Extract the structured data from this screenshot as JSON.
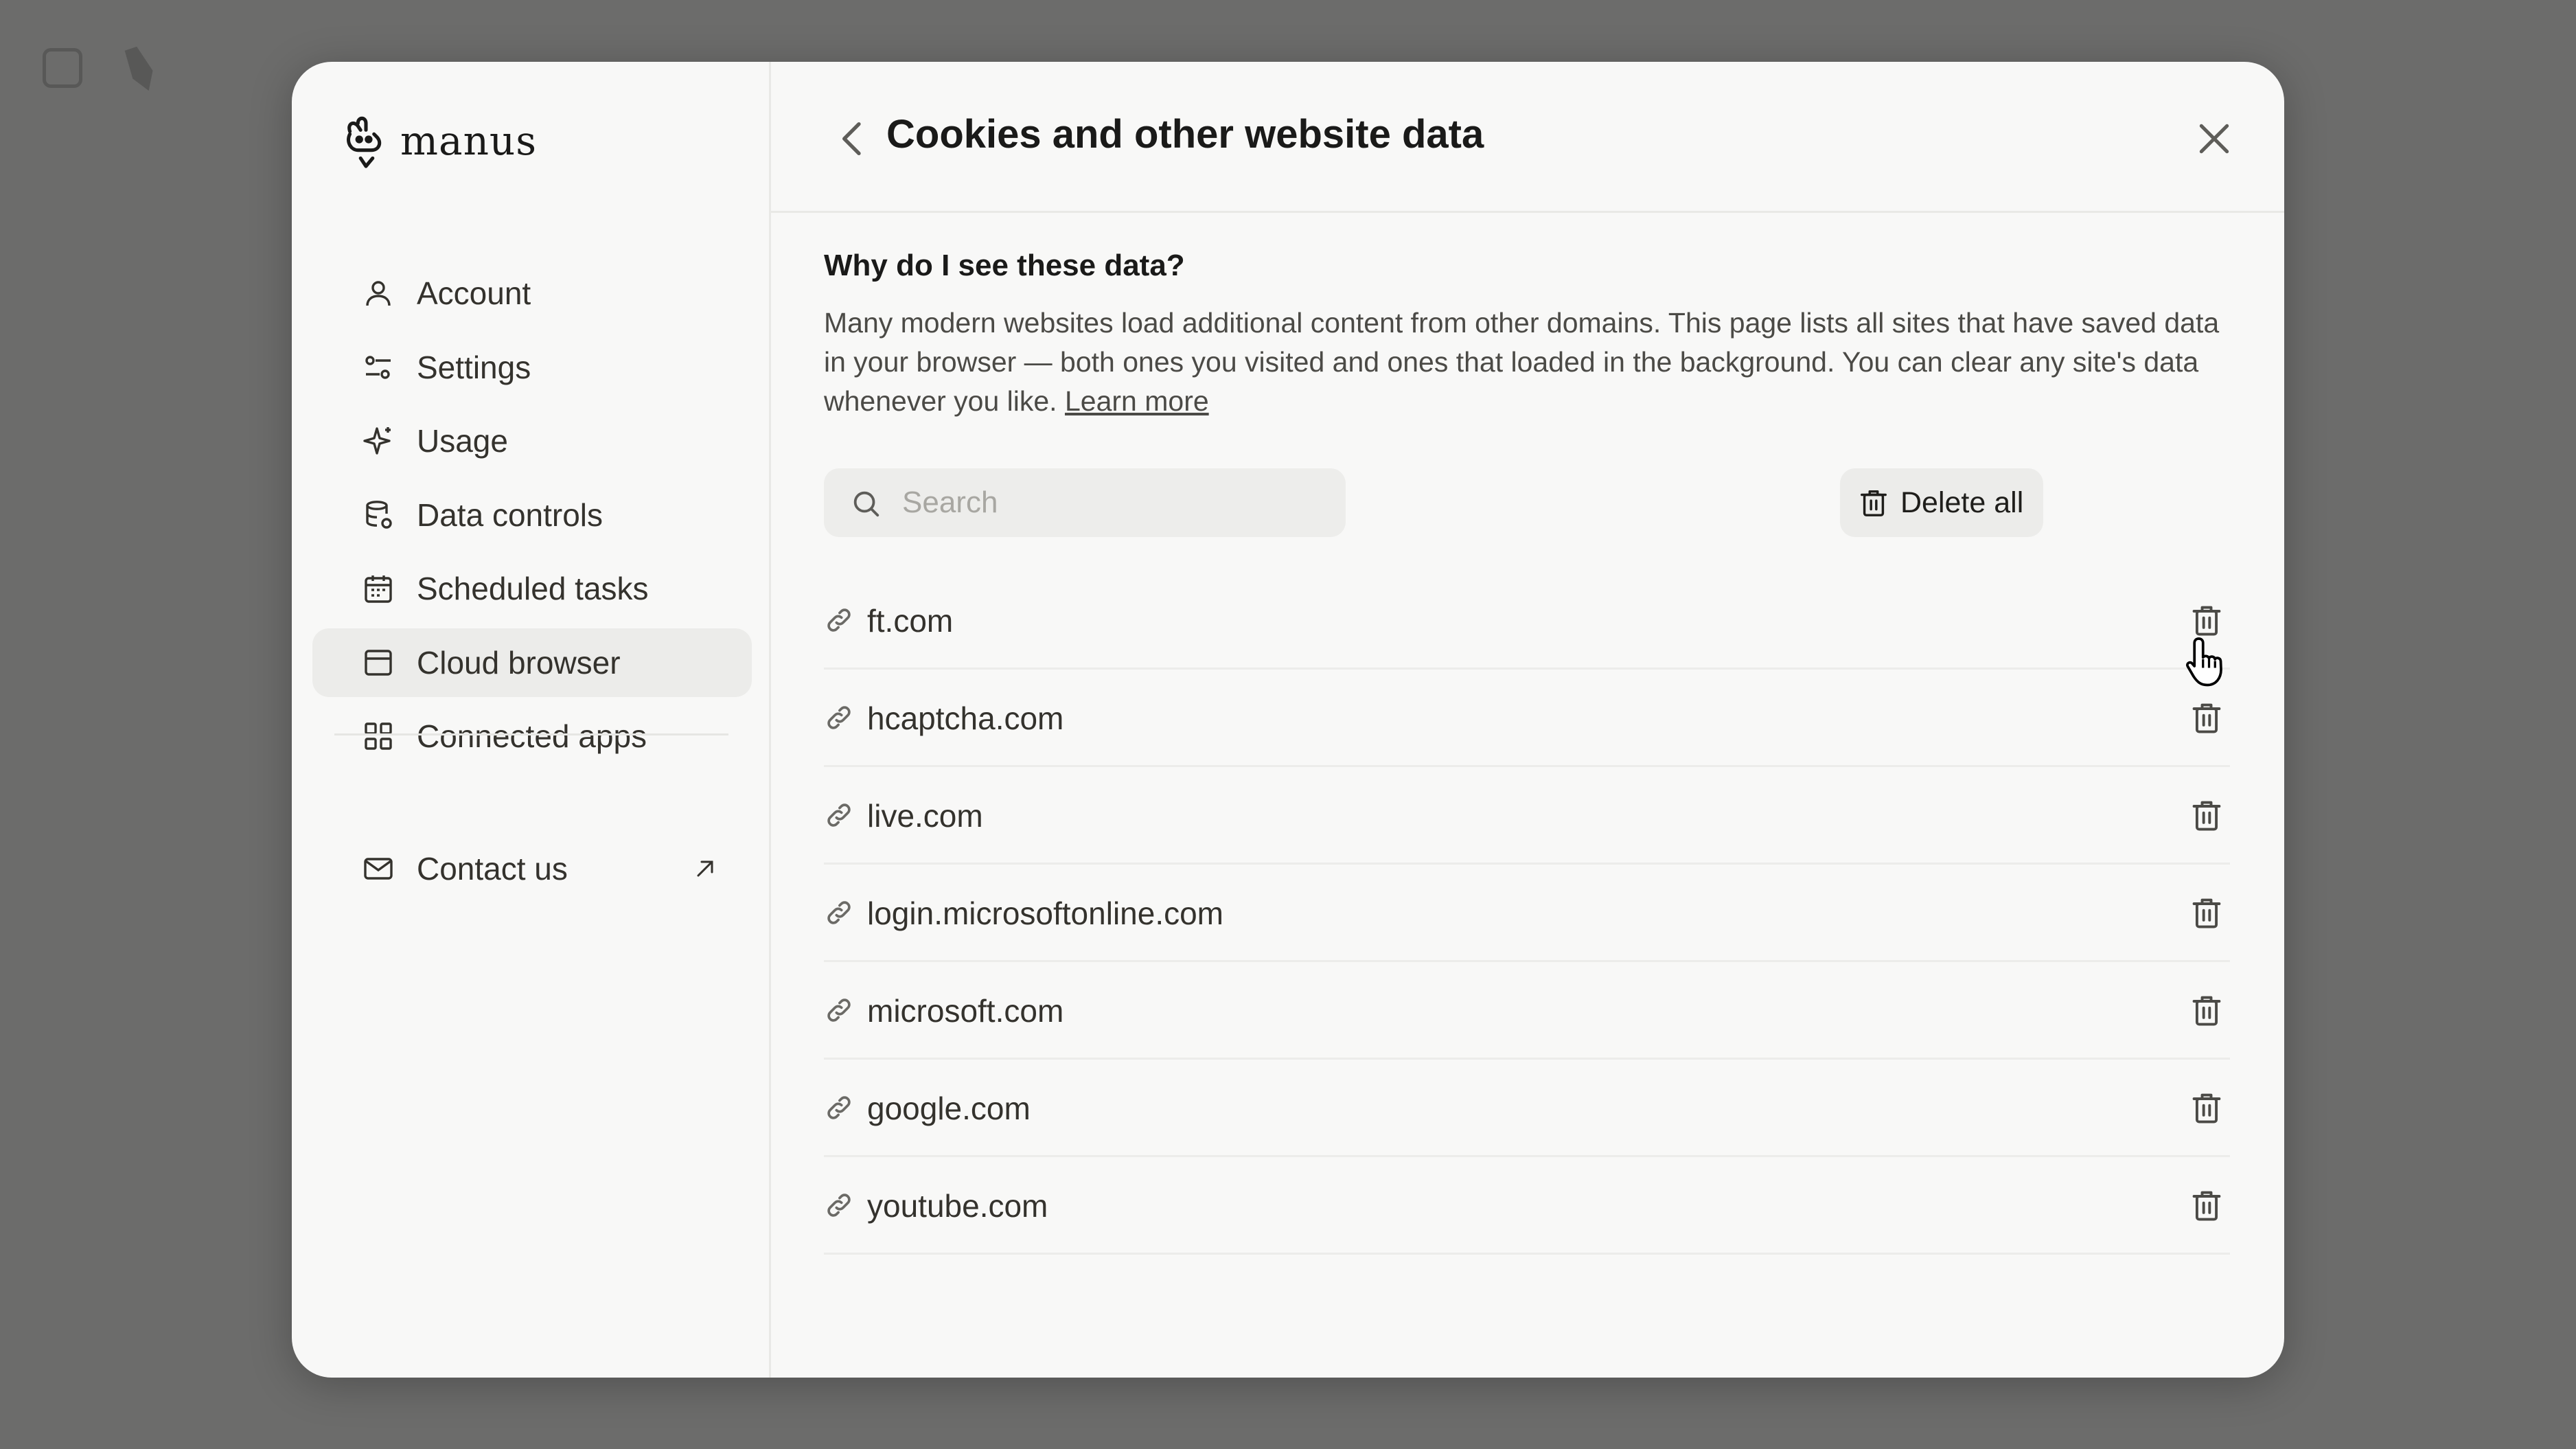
{
  "brand": {
    "name": "manus"
  },
  "sidebar": {
    "items": [
      {
        "label": "Account",
        "icon": "user-icon"
      },
      {
        "label": "Settings",
        "icon": "sliders-icon"
      },
      {
        "label": "Usage",
        "icon": "sparkle-icon"
      },
      {
        "label": "Data controls",
        "icon": "database-icon"
      },
      {
        "label": "Scheduled tasks",
        "icon": "calendar-icon"
      },
      {
        "label": "Cloud browser",
        "icon": "browser-window-icon",
        "active": true
      },
      {
        "label": "Connected apps",
        "icon": "grid-icon"
      }
    ],
    "contact": {
      "label": "Contact us",
      "icon": "mail-icon"
    }
  },
  "header": {
    "title": "Cookies and other website data"
  },
  "explain": {
    "heading": "Why do I see these data?",
    "text": "Many modern websites load additional content from other domains. This page lists all sites that have saved data in your browser — both ones you visited and ones that loaded in the background. You can clear any site's data whenever you like.",
    "learn_more": "Learn more"
  },
  "search": {
    "placeholder": "Search",
    "value": ""
  },
  "toolbar": {
    "delete_all_label": "Delete all"
  },
  "sites": [
    "ft.com",
    "hcaptcha.com",
    "live.com",
    "login.microsoftonline.com",
    "microsoft.com",
    "google.com",
    "youtube.com"
  ],
  "colors": {
    "backdrop": "#6c6c6b",
    "modal": "#f8f8f7",
    "active_item": "#ececea",
    "text": "#34322d"
  }
}
